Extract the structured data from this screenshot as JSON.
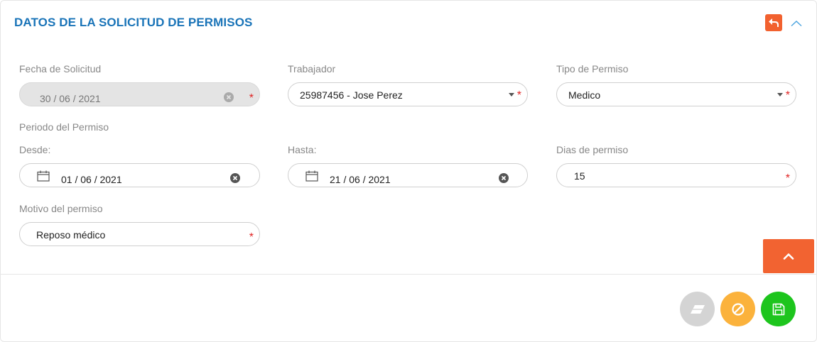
{
  "header": {
    "title": "DATOS DE LA SOLICITUD DE PERMISOS",
    "back_icon": "undo-arrow-icon",
    "collapse_icon": "chevron-up-icon",
    "accent_color": "#1a74b8",
    "back_color": "#f2612f"
  },
  "form": {
    "fecha_solicitud": {
      "label": "Fecha de Solicitud",
      "value": "30 / 06 / 2021",
      "disabled": true,
      "required": true
    },
    "trabajador": {
      "label": "Trabajador",
      "value": "25987456 - Jose Perez",
      "required": true
    },
    "tipo_permiso": {
      "label": "Tipo de Permiso",
      "value": "Medico",
      "required": true
    },
    "periodo_label": "Periodo del Permiso",
    "desde": {
      "label": "Desde:",
      "value": "01 / 06 / 2021"
    },
    "hasta": {
      "label": "Hasta:",
      "value": "21 / 06 / 2021"
    },
    "dias": {
      "label": "Dias de permiso",
      "value": "15",
      "required": true
    },
    "motivo": {
      "label": "Motivo del permiso",
      "value": "Reposo médico",
      "required": true
    },
    "required_mark": "*"
  },
  "actions": {
    "scroll_top_icon": "chevron-up-icon",
    "clear": {
      "icon": "eraser-icon",
      "color": "#d4d4d4"
    },
    "cancel": {
      "icon": "ban-icon",
      "color": "#fbb23c"
    },
    "save": {
      "icon": "floppy-disk-icon",
      "color": "#1dc51d"
    }
  }
}
